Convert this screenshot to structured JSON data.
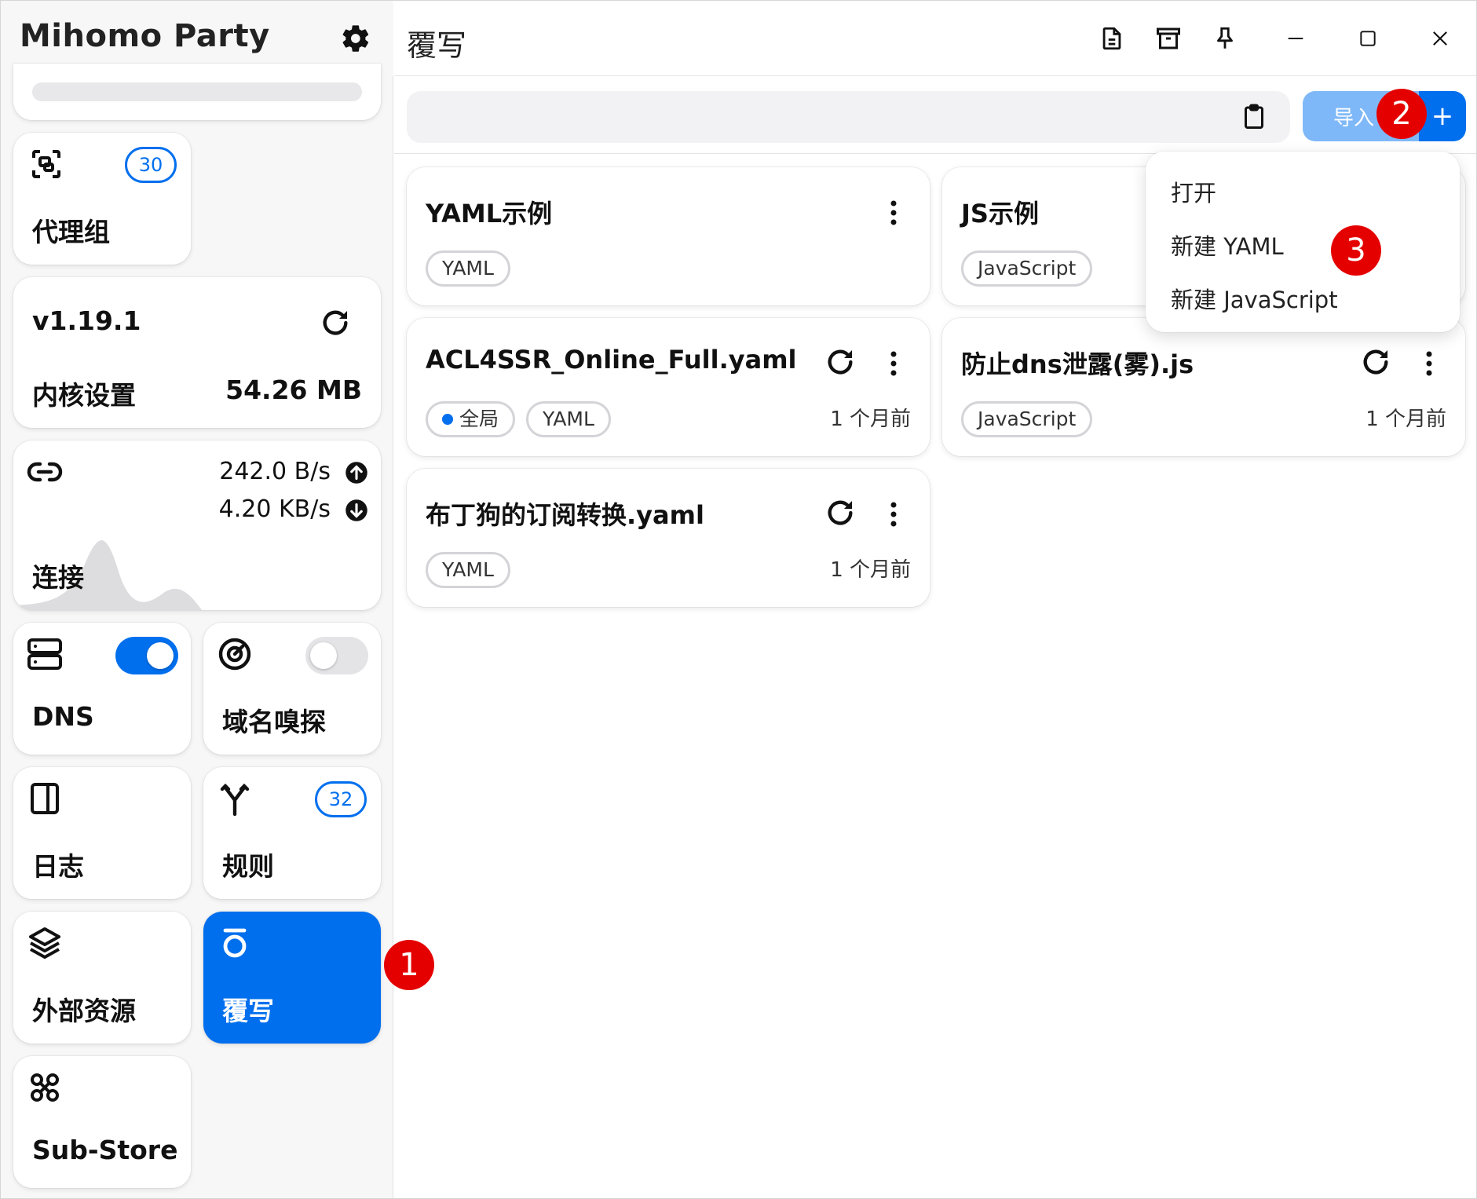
{
  "app": {
    "title": "Mihomo Party"
  },
  "sidebar": {
    "proxy_groups": {
      "label": "代理组",
      "count": "30"
    },
    "core": {
      "version": "v1.19.1",
      "label": "内核设置",
      "memory": "54.26 MB"
    },
    "connections": {
      "label": "连接",
      "upload": "242.0 B/s",
      "download": "4.20 KB/s"
    },
    "dns": {
      "label": "DNS",
      "enabled": true
    },
    "sniffer": {
      "label": "域名嗅探",
      "enabled": false
    },
    "logs": {
      "label": "日志"
    },
    "rules": {
      "label": "规则",
      "count": "32"
    },
    "resources": {
      "label": "外部资源"
    },
    "override": {
      "label": "覆写",
      "active": true
    },
    "substore": {
      "label": "Sub-Store"
    }
  },
  "page": {
    "title": "覆写"
  },
  "toolbar": {
    "url_value": "",
    "import_label": "导入",
    "add_label": "+"
  },
  "dropdown": {
    "items": [
      "打开",
      "新建 YAML",
      "新建 JavaScript"
    ]
  },
  "profiles": [
    {
      "title": "YAML示例",
      "chips": [
        "YAML"
      ],
      "time": ""
    },
    {
      "title": "JS示例",
      "chips": [
        "JavaScript"
      ],
      "time": ""
    },
    {
      "title": "ACL4SSR_Online_Full.yaml",
      "chips": [
        "全局",
        "YAML"
      ],
      "time": "1 个月前"
    },
    {
      "title": "防止dns泄露(雾).js",
      "chips": [
        "JavaScript"
      ],
      "time": "1 个月前"
    },
    {
      "title": "布丁狗的订阅转换.yaml",
      "chips": [
        "YAML"
      ],
      "time": "1 个月前"
    }
  ],
  "markers": [
    "1",
    "2",
    "3"
  ],
  "colors": {
    "accent": "#006fee",
    "marker": "#e50000",
    "import_bg": "#7fb8f8"
  }
}
